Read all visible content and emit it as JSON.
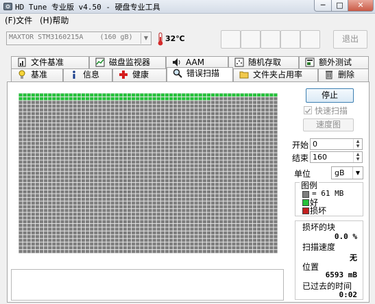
{
  "window": {
    "title": "HD Tune 专业版 v4.50 - 硬盘专业工具",
    "minimize_glyph": "─",
    "maximize_glyph": "□",
    "close_glyph": "✕"
  },
  "menu": [
    {
      "label": "(F)文件"
    },
    {
      "label": "(H)帮助"
    }
  ],
  "toolbar": {
    "drive": "MAXTOR STM3160215A    (160 gB)",
    "temperature": "32℃",
    "exit_label": "退出"
  },
  "tabs_top": [
    {
      "label": "文件基准",
      "icon": "file-benchmark-icon"
    },
    {
      "label": "磁盘监视器",
      "icon": "disk-monitor-icon"
    },
    {
      "label": "AAM",
      "icon": "speaker-icon"
    },
    {
      "label": "随机存取",
      "icon": "random-access-icon"
    },
    {
      "label": "额外测试",
      "icon": "extra-tests-icon"
    }
  ],
  "tabs_bottom": [
    {
      "label": "基准",
      "icon": "benchmark-icon"
    },
    {
      "label": "信息",
      "icon": "info-icon"
    },
    {
      "label": "健康",
      "icon": "health-cross-icon"
    },
    {
      "label": "错误扫描",
      "icon": "magnifier-icon",
      "active": true
    },
    {
      "label": "文件夹占用率",
      "icon": "folder-icon"
    },
    {
      "label": "删除",
      "icon": "trash-icon"
    }
  ],
  "scan": {
    "stop_label": "停止",
    "quick_scan_label": "快速扫描",
    "quick_scan_checked": true,
    "speed_map_label": "速度图",
    "start_label": "开始",
    "start_value": "0",
    "end_label": "结束",
    "end_value": "160",
    "unit_label": "单位",
    "unit_value": "gB",
    "legend_title": "图例",
    "legend_block": "= 61 MB",
    "legend_good": "好",
    "legend_bad": "损坏",
    "damaged_label": "损坏的块",
    "damaged_value": "0.0 %",
    "speed_label": "扫描速度",
    "speed_value": "无",
    "position_label": "位置",
    "position_value": "6593 mB",
    "elapsed_label": "已过去的时间",
    "elapsed_value": "0:02",
    "grid_columns": 62,
    "grid_rows": 43,
    "good_blocks": 108,
    "log_text": ""
  },
  "colors": {
    "block_unscanned": "#7d7d7d",
    "block_good": "#25c13a",
    "block_bad": "#c42020",
    "grid_line": "#e6e6e6"
  }
}
